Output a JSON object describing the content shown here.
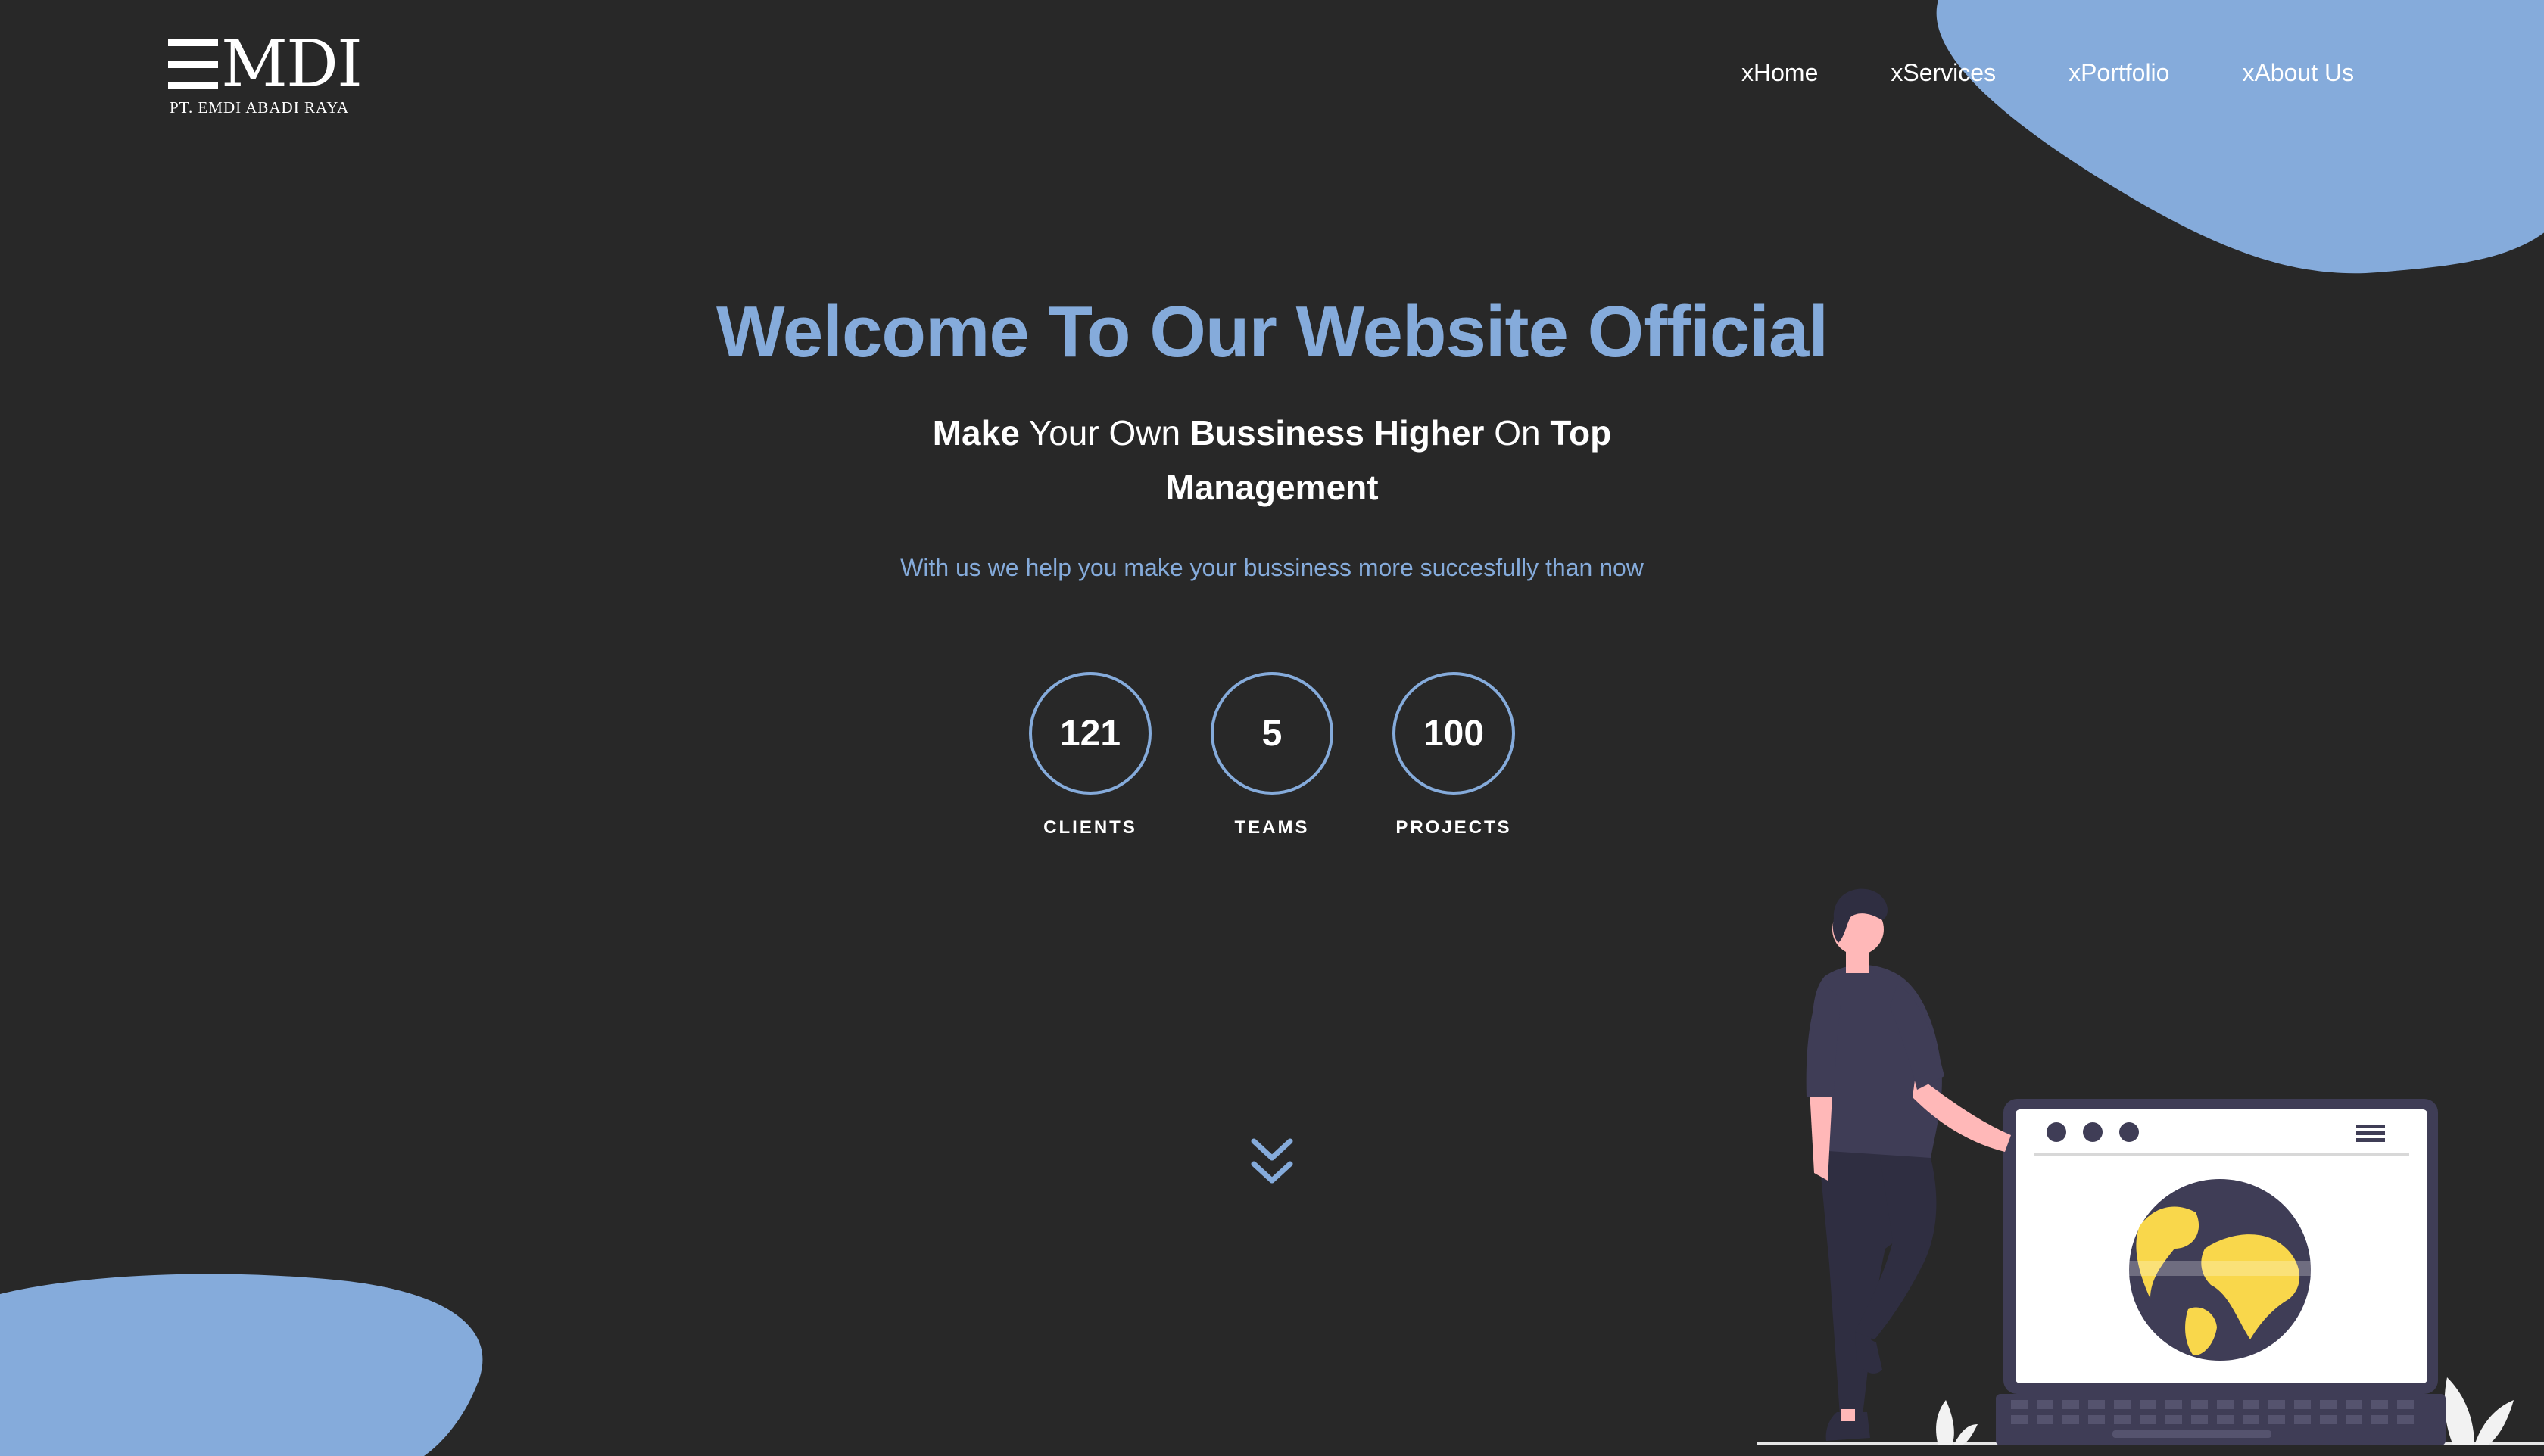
{
  "header": {
    "logo_text": "MDI",
    "logo_tagline": "PT. EMDI ABADI RAYA",
    "nav": [
      {
        "label": "xHome"
      },
      {
        "label": "xServices"
      },
      {
        "label": "xPortfolio"
      },
      {
        "label": "xAbout Us"
      }
    ]
  },
  "hero": {
    "title": "Welcome To Our Website Official",
    "subtitle_parts": [
      "Make",
      " Your Own ",
      "Bussiness Higher",
      " On ",
      "Top",
      "Management"
    ],
    "description": "With us we help you make your bussiness more succesfully than now"
  },
  "stats": [
    {
      "value": "121",
      "label": "CLIENTS"
    },
    {
      "value": "5",
      "label": "TEAMS"
    },
    {
      "value": "100",
      "label": "PROJECTS"
    }
  ],
  "icons": {
    "scroll": "double-chevron-down-icon",
    "illustration": "person-with-laptop-globe-illustration"
  },
  "colors": {
    "background": "#282828",
    "accent": "#85abdb",
    "text": "#ffffff"
  }
}
